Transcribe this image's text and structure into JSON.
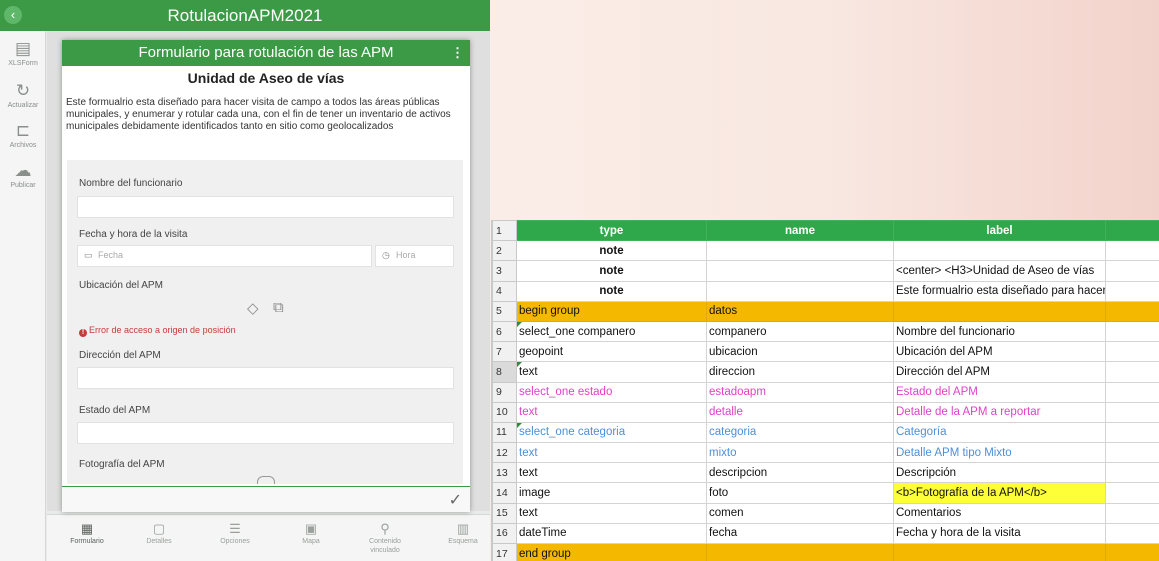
{
  "app": {
    "title": "RotulacionAPM2021",
    "sidebar": [
      {
        "icon": "document-icon",
        "glyph": "▤",
        "label": "XLSForm"
      },
      {
        "icon": "refresh-icon",
        "glyph": "↻",
        "label": "Actualizar"
      },
      {
        "icon": "folder-icon",
        "glyph": "⊏",
        "label": "Archivos"
      },
      {
        "icon": "cloud-upload-icon",
        "glyph": "☁",
        "label": "Publicar"
      }
    ],
    "bottom_nav": [
      {
        "icon": "form-icon",
        "glyph": "▦",
        "label": "Formulario"
      },
      {
        "icon": "details-icon",
        "glyph": "▢",
        "label": "Detalles"
      },
      {
        "icon": "options-icon",
        "glyph": "☰",
        "label": "Opciones"
      },
      {
        "icon": "map-icon",
        "glyph": "▣",
        "label": "Mapa"
      },
      {
        "icon": "link-icon",
        "glyph": "⚲",
        "label": "Contenido vinculado"
      },
      {
        "icon": "schema-icon",
        "glyph": "▥",
        "label": "Esquema"
      }
    ]
  },
  "form": {
    "header": "Formulario para rotulación de las APM",
    "subtitle": "Unidad de Aseo de vías",
    "intro": "Este formualrio esta diseñado para hacer visita de campo a todos las áreas públicas municipales, y enumerar y rotular cada una, con el fin de tener un inventario de activos municipales debidamente identificados tanto en sitio como geolocalizados",
    "q_funcionario": "Nombre del funcionario",
    "q_fecha": "Fecha y hora de la visita",
    "fecha_placeholder": "Fecha",
    "hora_placeholder": "Hora",
    "q_ubicacion": "Ubicación del APM",
    "error_text": "Error de acceso a origen de posición",
    "q_direccion": "Dirección del APM",
    "q_estado": "Estado del APM",
    "q_foto": "Fotografía del APM"
  },
  "sheet": {
    "headers": [
      "type",
      "name",
      "label"
    ],
    "rows": [
      {
        "n": "1",
        "type": "type",
        "name": "name",
        "label": "label",
        "style": "hdr"
      },
      {
        "n": "2",
        "type": "note",
        "name": "",
        "label": "",
        "style": "note"
      },
      {
        "n": "3",
        "type": "note",
        "name": "",
        "label": "<center> <H3>Unidad de Aseo de vías",
        "style": "note"
      },
      {
        "n": "4",
        "type": "note",
        "name": "",
        "label": "Este formualrio esta diseñado para hacer",
        "style": "note"
      },
      {
        "n": "5",
        "type": "begin group",
        "name": "datos",
        "label": "",
        "style": "grp"
      },
      {
        "n": "6",
        "type": "select_one companero",
        "name": "companero",
        "label": "Nombre del funcionario",
        "style": ""
      },
      {
        "n": "7",
        "type": "geopoint",
        "name": "ubicacion",
        "label": "Ubicación del APM",
        "style": ""
      },
      {
        "n": "8",
        "type": "text",
        "name": "direccion",
        "label": "Dirección del APM",
        "style": ""
      },
      {
        "n": "9",
        "type": "select_one estado",
        "name": "estadoapm",
        "label": "Estado del APM",
        "style": "pink"
      },
      {
        "n": "10",
        "type": "text",
        "name": "detalle",
        "label": "Detalle de la APM a reportar",
        "style": "pink"
      },
      {
        "n": "11",
        "type": "select_one categoria",
        "name": "categoria",
        "label": "Categoría",
        "style": "blue"
      },
      {
        "n": "12",
        "type": "text",
        "name": "mixto",
        "label": "Detalle APM tipo Mixto",
        "style": "blue"
      },
      {
        "n": "13",
        "type": "text",
        "name": "descripcion",
        "label": "Descripción",
        "style": ""
      },
      {
        "n": "14",
        "type": "image",
        "name": "foto",
        "label": "<b>Fotografía de la APM</b>",
        "style": "yellow"
      },
      {
        "n": "15",
        "type": "text",
        "name": "comen",
        "label": "Comentarios",
        "style": ""
      },
      {
        "n": "16",
        "type": "dateTime",
        "name": "fecha",
        "label": "Fecha y hora de la visita",
        "style": ""
      },
      {
        "n": "17",
        "type": "end group",
        "name": "",
        "label": "",
        "style": "grp"
      }
    ],
    "colors": {
      "header_green": "#2ea84a",
      "group_orange": "#f5b800",
      "pink": "#e040c8",
      "blue": "#4d8fd8",
      "yellow": "#ffff38"
    }
  }
}
